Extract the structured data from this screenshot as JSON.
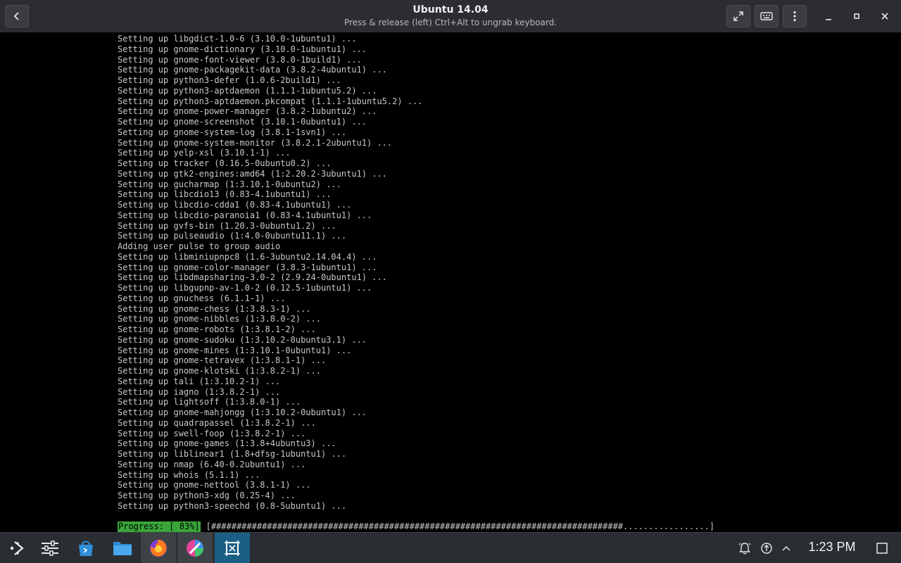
{
  "window": {
    "title": "Ubuntu 14.04",
    "subtitle": "Press & release (left) Ctrl+Alt to ungrab keyboard."
  },
  "terminal": {
    "lines": [
      "Setting up libgdict-1.0-6 (3.10.0-1ubuntu1) ...",
      "Setting up gnome-dictionary (3.10.0-1ubuntu1) ...",
      "Setting up gnome-font-viewer (3.8.0-1build1) ...",
      "Setting up gnome-packagekit-data (3.8.2-4ubuntu1) ...",
      "Setting up python3-defer (1.0.6-2build1) ...",
      "Setting up python3-aptdaemon (1.1.1-1ubuntu5.2) ...",
      "Setting up python3-aptdaemon.pkcompat (1.1.1-1ubuntu5.2) ...",
      "Setting up gnome-power-manager (3.8.2-1ubuntu2) ...",
      "Setting up gnome-screenshot (3.10.1-0ubuntu1) ...",
      "Setting up gnome-system-log (3.8.1-1svn1) ...",
      "Setting up gnome-system-monitor (3.8.2.1-2ubuntu1) ...",
      "Setting up yelp-xsl (3.10.1-1) ...",
      "Setting up tracker (0.16.5-0ubuntu0.2) ...",
      "Setting up gtk2-engines:amd64 (1:2.20.2-3ubuntu1) ...",
      "Setting up gucharmap (1:3.10.1-0ubuntu2) ...",
      "Setting up libcdio13 (0.83-4.1ubuntu1) ...",
      "Setting up libcdio-cdda1 (0.83-4.1ubuntu1) ...",
      "Setting up libcdio-paranoia1 (0.83-4.1ubuntu1) ...",
      "Setting up gvfs-bin (1.20.3-0ubuntu1.2) ...",
      "Setting up pulseaudio (1:4.0-0ubuntu11.1) ...",
      "Adding user pulse to group audio",
      "Setting up libminiupnpc8 (1.6-3ubuntu2.14.04.4) ...",
      "Setting up gnome-color-manager (3.8.3-1ubuntu1) ...",
      "Setting up libdmapsharing-3.0-2 (2.9.24-0ubuntu1) ...",
      "Setting up libgupnp-av-1.0-2 (0.12.5-1ubuntu1) ...",
      "Setting up gnuchess (6.1.1-1) ...",
      "Setting up gnome-chess (1:3.8.3-1) ...",
      "Setting up gnome-nibbles (1:3.8.0-2) ...",
      "Setting up gnome-robots (1:3.8.1-2) ...",
      "Setting up gnome-sudoku (1:3.10.2-0ubuntu3.1) ...",
      "Setting up gnome-mines (1:3.10.1-0ubuntu1) ...",
      "Setting up gnome-tetravex (1:3.8.1-1) ...",
      "Setting up gnome-klotski (1:3.8.2-1) ...",
      "Setting up tali (1:3.10.2-1) ...",
      "Setting up iagno (1:3.8.2-1) ...",
      "Setting up lightsoff (1:3.8.0-1) ...",
      "Setting up gnome-mahjongg (1:3.10.2-0ubuntu1) ...",
      "Setting up quadrapassel (1:3.8.2-1) ...",
      "Setting up swell-foop (1:3.8.2-1) ...",
      "Setting up gnome-games (1:3.8+4ubuntu3) ...",
      "Setting up liblinear1 (1.8+dfsg-1ubuntu1) ...",
      "Setting up nmap (6.40-0.2ubuntu1) ...",
      "Setting up whois (5.1.1) ...",
      "Setting up gnome-nettool (3.8.1-1) ...",
      "Setting up python3-xdg (0.25-4) ...",
      "Setting up python3-speechd (0.8-5ubuntu1) ..."
    ],
    "progress_label": "Progress: [ 83%]",
    "progress_bar": "[#################################################################################.................]",
    "progress_fraction": 0.83
  },
  "taskbar": {
    "apps": [
      {
        "name": "application-launcher-icon"
      },
      {
        "name": "system-settings-icon"
      },
      {
        "name": "discover-store-icon"
      },
      {
        "name": "file-manager-icon"
      },
      {
        "name": "firefox-icon"
      },
      {
        "name": "color-app-icon"
      },
      {
        "name": "virt-manager-icon"
      }
    ],
    "clock": "1:23 PM"
  },
  "colors": {
    "titlebar_bg": "#2b2d31",
    "terminal_bg": "#000000",
    "terminal_fg": "#c8c8c8",
    "progress_green": "#3aa63a",
    "taskbar_bg": "#2a2e32",
    "active_task_blue": "#1c5f85"
  }
}
